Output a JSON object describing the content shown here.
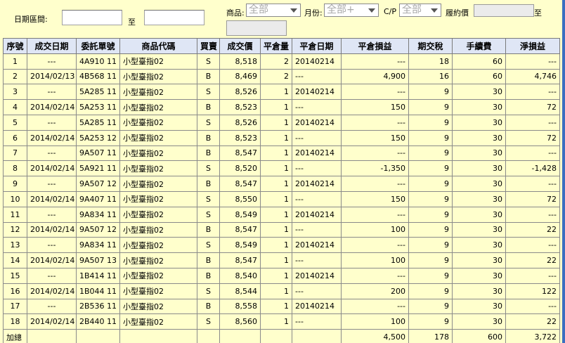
{
  "filters": {
    "date_range_label": "日期區間:",
    "to_label": "至",
    "product_label": "商品:",
    "product_value": "全部",
    "month_label": "月份:",
    "month_value": "全部+",
    "cp_label": "C/P",
    "cp_value": "全部",
    "strike_label": "履約價",
    "strike_to_label": "至"
  },
  "table": {
    "headers": [
      "序號",
      "成交日期",
      "委託單號",
      "商品代碼",
      "買賣",
      "成交價",
      "平倉量",
      "平倉日期",
      "平倉損益",
      "期交稅",
      "手續費",
      "淨損益"
    ],
    "rows": [
      [
        "1",
        "---",
        "4A910 11",
        "小型臺指02",
        "S",
        "8,518",
        "2",
        "20140214",
        "---",
        "18",
        "60",
        "---"
      ],
      [
        "2",
        "2014/02/13",
        "4B568 11",
        "小型臺指02",
        "B",
        "8,469",
        "2",
        "---",
        "4,900",
        "16",
        "60",
        "4,746"
      ],
      [
        "3",
        "---",
        "5A285 11",
        "小型臺指02",
        "S",
        "8,526",
        "1",
        "20140214",
        "---",
        "9",
        "30",
        "---"
      ],
      [
        "4",
        "2014/02/14",
        "5A253 11",
        "小型臺指02",
        "B",
        "8,523",
        "1",
        "---",
        "150",
        "9",
        "30",
        "72"
      ],
      [
        "5",
        "---",
        "5A285 11",
        "小型臺指02",
        "S",
        "8,526",
        "1",
        "20140214",
        "---",
        "9",
        "30",
        "---"
      ],
      [
        "6",
        "2014/02/14",
        "5A253 12",
        "小型臺指02",
        "B",
        "8,523",
        "1",
        "---",
        "150",
        "9",
        "30",
        "72"
      ],
      [
        "7",
        "---",
        "9A507 11",
        "小型臺指02",
        "B",
        "8,547",
        "1",
        "20140214",
        "---",
        "9",
        "30",
        "---"
      ],
      [
        "8",
        "2014/02/14",
        "5A921 11",
        "小型臺指02",
        "S",
        "8,520",
        "1",
        "---",
        "-1,350",
        "9",
        "30",
        "-1,428"
      ],
      [
        "9",
        "---",
        "9A507 12",
        "小型臺指02",
        "B",
        "8,547",
        "1",
        "20140214",
        "---",
        "9",
        "30",
        "---"
      ],
      [
        "10",
        "2014/02/14",
        "9A407 11",
        "小型臺指02",
        "S",
        "8,550",
        "1",
        "---",
        "150",
        "9",
        "30",
        "72"
      ],
      [
        "11",
        "---",
        "9A834 11",
        "小型臺指02",
        "S",
        "8,549",
        "1",
        "20140214",
        "---",
        "9",
        "30",
        "---"
      ],
      [
        "12",
        "2014/02/14",
        "9A507 12",
        "小型臺指02",
        "B",
        "8,547",
        "1",
        "---",
        "100",
        "9",
        "30",
        "22"
      ],
      [
        "13",
        "---",
        "9A834 11",
        "小型臺指02",
        "S",
        "8,549",
        "1",
        "20140214",
        "---",
        "9",
        "30",
        "---"
      ],
      [
        "14",
        "2014/02/14",
        "9A507 13",
        "小型臺指02",
        "B",
        "8,547",
        "1",
        "---",
        "100",
        "9",
        "30",
        "22"
      ],
      [
        "15",
        "---",
        "1B414 11",
        "小型臺指02",
        "B",
        "8,540",
        "1",
        "20140214",
        "---",
        "9",
        "30",
        "---"
      ],
      [
        "16",
        "2014/02/14",
        "1B044 11",
        "小型臺指02",
        "S",
        "8,544",
        "1",
        "---",
        "200",
        "9",
        "30",
        "122"
      ],
      [
        "17",
        "---",
        "2B536 11",
        "小型臺指02",
        "B",
        "8,558",
        "1",
        "20140214",
        "---",
        "9",
        "30",
        "---"
      ],
      [
        "18",
        "2014/02/14",
        "2B440 11",
        "小型臺指02",
        "S",
        "8,560",
        "1",
        "---",
        "100",
        "9",
        "30",
        "22"
      ]
    ],
    "total": [
      "加總",
      "",
      "",
      "",
      "",
      "",
      "",
      "",
      "4,500",
      "178",
      "600",
      "3,722"
    ]
  }
}
